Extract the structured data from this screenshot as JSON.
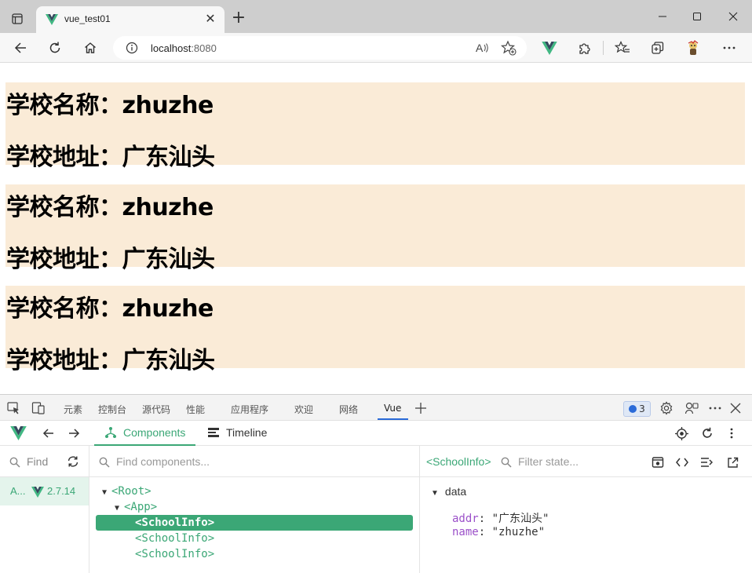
{
  "browser": {
    "tab_title": "vue_test01",
    "close_tab_glyph": "✕",
    "new_tab_glyph": "+",
    "url_host": "localhost",
    "url_port": ":8080"
  },
  "page": {
    "schools": [
      {
        "name_line": "学校名称：zhuzhe",
        "addr_line": "学校地址：广东汕头"
      },
      {
        "name_line": "学校名称：zhuzhe",
        "addr_line": "学校地址：广东汕头"
      },
      {
        "name_line": "学校名称：zhuzhe",
        "addr_line": "学校地址：广东汕头"
      }
    ],
    "background": "#faebd7"
  },
  "devtools": {
    "tabs": [
      "元素",
      "控制台",
      "源代码",
      "性能",
      "应用程序",
      "欢迎",
      "网络",
      "Vue"
    ],
    "active_tab": "Vue",
    "issues_count": "3",
    "vue": {
      "components_label": "Components",
      "timeline_label": "Timeline",
      "find_label": "Find",
      "app_name": "A...",
      "app_version": "2.7.14",
      "tree_search_placeholder": "Find components...",
      "tree": [
        {
          "label": "<Root>",
          "expanded": true
        },
        {
          "label": "<App>",
          "expanded": true
        },
        {
          "label": "<SchoolInfo>",
          "selected": true
        },
        {
          "label": "<SchoolInfo>"
        },
        {
          "label": "<SchoolInfo>"
        }
      ],
      "selected_component": "<SchoolInfo>",
      "state_filter_placeholder": "Filter state...",
      "state_section": "data",
      "state": [
        {
          "key": "addr",
          "value": "\"广东汕头\""
        },
        {
          "key": "name",
          "value": "\"zhuzhe\""
        }
      ],
      "accent": "#3ba776"
    }
  }
}
